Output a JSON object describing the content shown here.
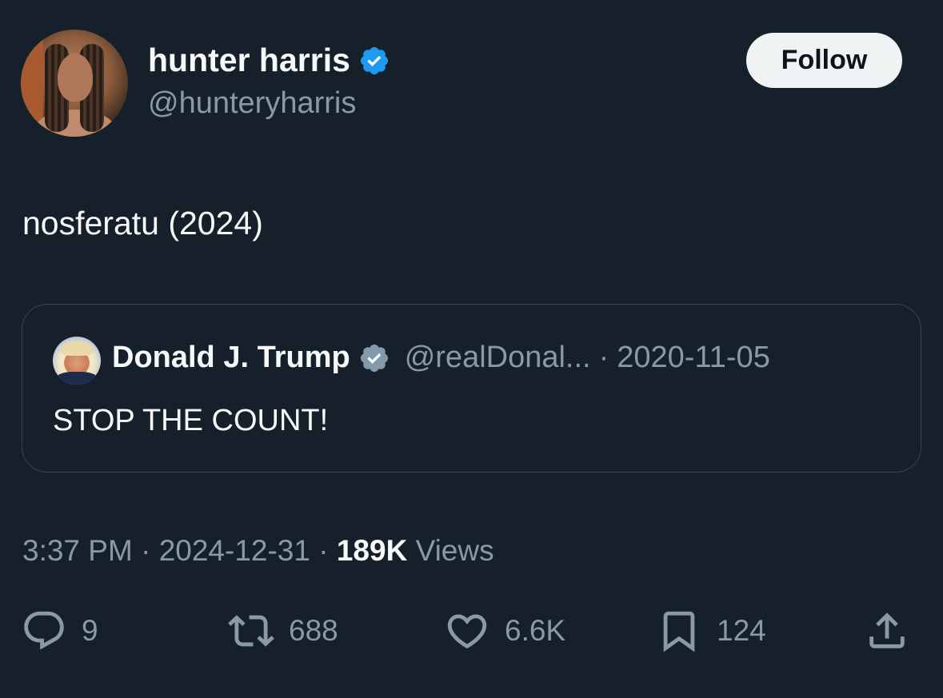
{
  "author": {
    "display_name": "hunter harris",
    "handle": "@hunteryharris",
    "verified": true
  },
  "follow_label": "Follow",
  "tweet_text": "nosferatu (2024)",
  "quoted": {
    "display_name": "Donald J. Trump",
    "handle": "@realDonal...",
    "separator": "·",
    "date": "2020-11-05",
    "text": "STOP THE COUNT!",
    "verified": true
  },
  "meta": {
    "time": "3:37 PM",
    "sep1": "·",
    "date": "2024-12-31",
    "sep2": "·",
    "views_count": "189K",
    "views_label": "Views"
  },
  "actions": {
    "replies": "9",
    "reposts": "688",
    "likes": "6.6K",
    "bookmarks": "124"
  },
  "colors": {
    "background": "#15202b",
    "text": "#f7f9f9",
    "secondary": "#8b98a5",
    "verified_blue": "#1d9bf0",
    "verified_gray": "#829aab"
  },
  "icons": [
    "verified-badge-icon",
    "reply-icon",
    "repost-icon",
    "like-icon",
    "bookmark-icon",
    "share-icon"
  ]
}
